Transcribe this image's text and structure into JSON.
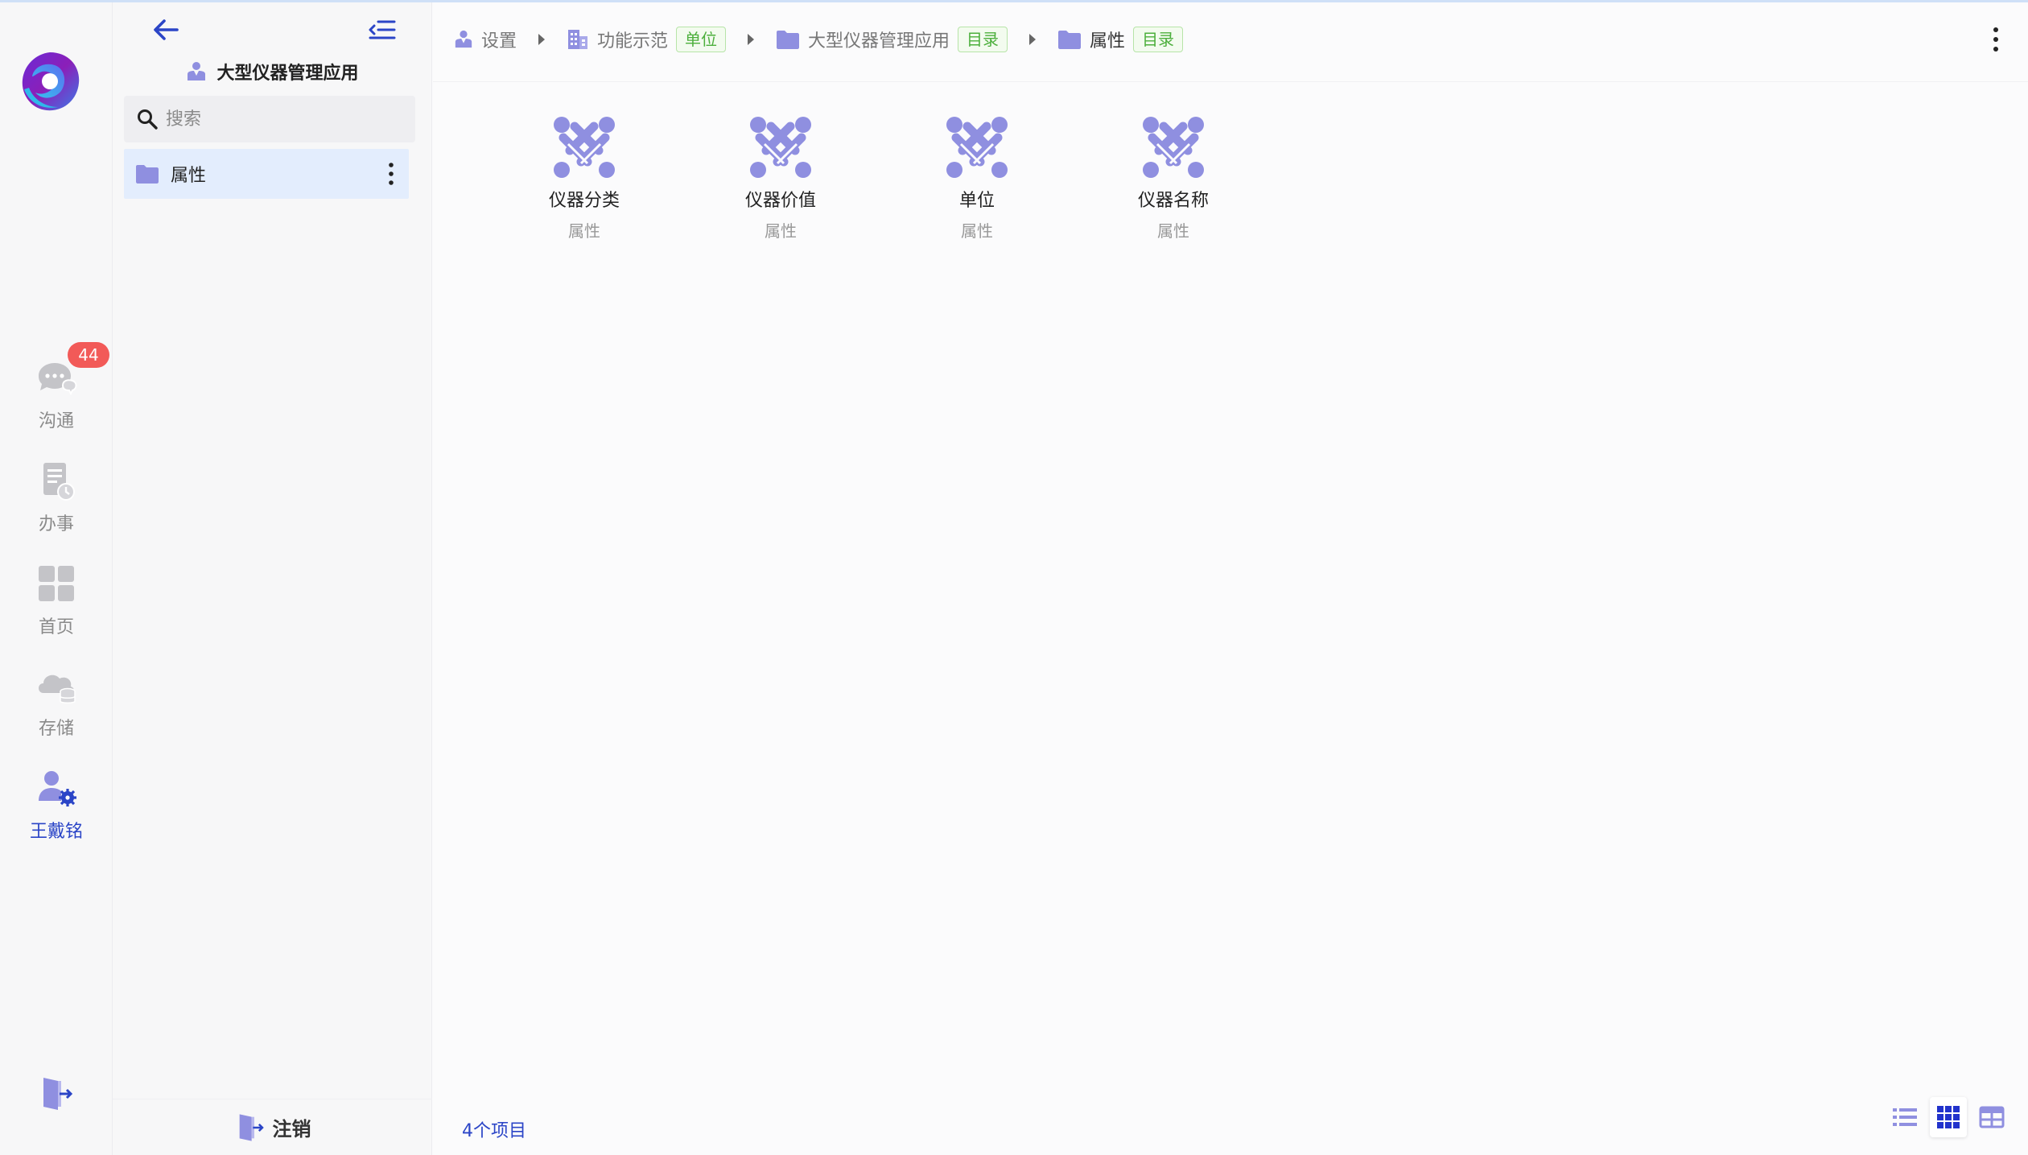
{
  "rail": {
    "items": [
      {
        "key": "chat",
        "label": "沟通",
        "icon": "chat-bubble-icon",
        "badge": "44",
        "active": false
      },
      {
        "key": "work",
        "label": "办事",
        "icon": "document-clock-icon",
        "active": false
      },
      {
        "key": "home",
        "label": "首页",
        "icon": "grid-icon",
        "active": false
      },
      {
        "key": "storage",
        "label": "存储",
        "icon": "cloud-database-icon",
        "active": false
      },
      {
        "key": "user",
        "label": "王戴铭",
        "icon": "user-settings-icon",
        "active": true
      }
    ],
    "exit_icon": "exit-door-icon"
  },
  "panel": {
    "title": "大型仪器管理应用",
    "search": {
      "placeholder": "搜索",
      "value": ""
    },
    "tree": [
      {
        "label": "属性",
        "icon": "folder-icon"
      }
    ],
    "logout_label": "注销"
  },
  "breadcrumb": [
    {
      "label": "设置",
      "icon": "person-badge-icon",
      "tag": ""
    },
    {
      "label": "功能示范",
      "icon": "building-icon",
      "tag": "单位"
    },
    {
      "label": "大型仪器管理应用",
      "icon": "folder-icon",
      "tag": "目录"
    },
    {
      "label": "属性",
      "icon": "folder-icon",
      "tag": "目录"
    }
  ],
  "items": [
    {
      "name": "仪器分类",
      "type": "属性",
      "icon": "joomla-knot-icon"
    },
    {
      "name": "仪器价值",
      "type": "属性",
      "icon": "joomla-knot-icon"
    },
    {
      "name": "单位",
      "type": "属性",
      "icon": "joomla-knot-icon"
    },
    {
      "name": "仪器名称",
      "type": "属性",
      "icon": "joomla-knot-icon"
    }
  ],
  "status": {
    "count_text": "4个项目"
  },
  "view_modes": [
    {
      "key": "list",
      "icon": "list-view-icon",
      "selected": false
    },
    {
      "key": "icons",
      "icon": "grid-view-icon",
      "selected": true
    },
    {
      "key": "table",
      "icon": "table-view-icon",
      "selected": false
    }
  ],
  "colors": {
    "accent": "#2b45c7",
    "icon_purple": "#8f8fe0",
    "badge_red": "#f25a58",
    "tag_green": "#4caf3c"
  }
}
